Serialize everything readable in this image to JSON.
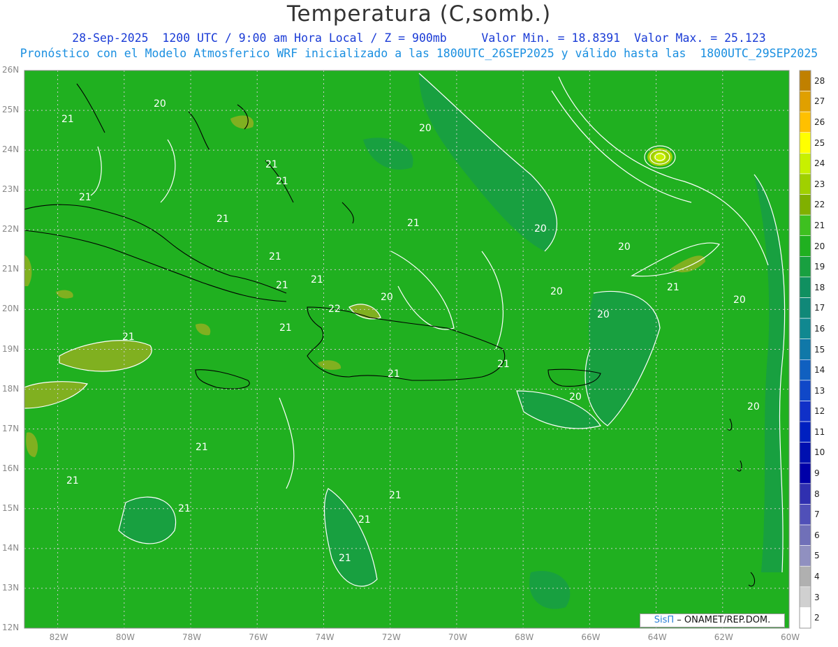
{
  "title": "Temperatura (C,somb.)",
  "subtitle_line1": "28-Sep-2025  1200 UTC / 9:00 am Hora Local / Z = 900mb     Valor Min. = 18.8391  Valor Max. = 25.123",
  "subtitle_line2": "Pronóstico con el Modelo Atmosferico WRF inicializado a las 1800UTC_26SEP2025 y válido hasta las  1800UTC_29SEP2025",
  "credit": {
    "brand": "SisΠ",
    "text": "– ONAMET/REP.DOM."
  },
  "map": {
    "lon_range": [
      -83,
      -60
    ],
    "lat_range": [
      12,
      26
    ],
    "lon_ticks": [
      "82W",
      "80W",
      "78W",
      "76W",
      "74W",
      "72W",
      "70W",
      "68W",
      "66W",
      "64W",
      "62W",
      "60W"
    ],
    "lat_ticks": [
      "26N",
      "25N",
      "24N",
      "23N",
      "22N",
      "21N",
      "20N",
      "19N",
      "18N",
      "17N",
      "16N",
      "15N",
      "14N",
      "13N",
      "12N"
    ],
    "min_value": 18.8391,
    "max_value": 25.123,
    "contour_labels": [
      "20",
      "21",
      "21",
      "21",
      "21",
      "21",
      "21",
      "21",
      "21",
      "22",
      "21",
      "21",
      "21",
      "20",
      "21",
      "21",
      "20",
      "21",
      "21",
      "20",
      "20",
      "20",
      "21",
      "20",
      "20",
      "20",
      "20",
      "21",
      "21",
      "21",
      "21"
    ]
  },
  "colorbar": {
    "levels": [
      "28",
      "27",
      "26",
      "25",
      "24",
      "23",
      "22",
      "21",
      "20",
      "19",
      "18",
      "17",
      "16",
      "15",
      "14",
      "13",
      "12",
      "11",
      "10",
      "9",
      "8",
      "7",
      "6",
      "5",
      "4",
      "3",
      "2"
    ],
    "colors": [
      "#c08000",
      "#e0a000",
      "#ffc000",
      "#ffff00",
      "#c8f000",
      "#a0d000",
      "#80b000",
      "#3ec020",
      "#20b020",
      "#18a040",
      "#109060",
      "#108878",
      "#108890",
      "#1078a8",
      "#1060c0",
      "#1048c8",
      "#1030c8",
      "#0020c0",
      "#0010b0",
      "#0000a8",
      "#3030b0",
      "#5050b8",
      "#7070b8",
      "#9090c0",
      "#b0b0b0",
      "#d0d0d0",
      "#ffffff"
    ]
  }
}
